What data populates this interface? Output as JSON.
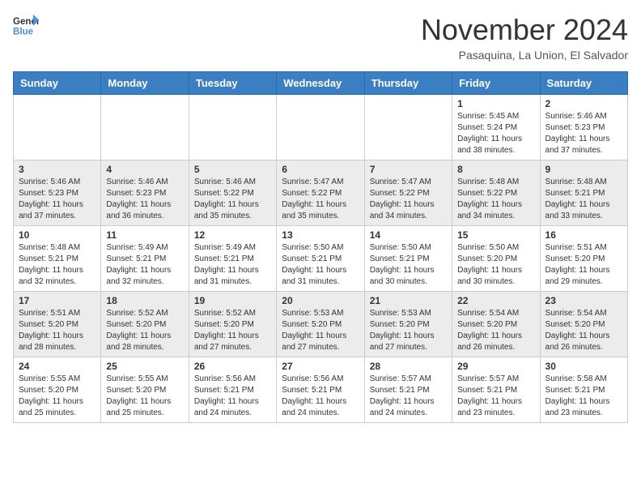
{
  "logo": {
    "line1": "General",
    "line2": "Blue"
  },
  "header": {
    "month": "November 2024",
    "location": "Pasaquina, La Union, El Salvador"
  },
  "weekdays": [
    "Sunday",
    "Monday",
    "Tuesday",
    "Wednesday",
    "Thursday",
    "Friday",
    "Saturday"
  ],
  "weeks": [
    [
      {
        "day": "",
        "info": ""
      },
      {
        "day": "",
        "info": ""
      },
      {
        "day": "",
        "info": ""
      },
      {
        "day": "",
        "info": ""
      },
      {
        "day": "",
        "info": ""
      },
      {
        "day": "1",
        "info": "Sunrise: 5:45 AM\nSunset: 5:24 PM\nDaylight: 11 hours\nand 38 minutes."
      },
      {
        "day": "2",
        "info": "Sunrise: 5:46 AM\nSunset: 5:23 PM\nDaylight: 11 hours\nand 37 minutes."
      }
    ],
    [
      {
        "day": "3",
        "info": "Sunrise: 5:46 AM\nSunset: 5:23 PM\nDaylight: 11 hours\nand 37 minutes."
      },
      {
        "day": "4",
        "info": "Sunrise: 5:46 AM\nSunset: 5:23 PM\nDaylight: 11 hours\nand 36 minutes."
      },
      {
        "day": "5",
        "info": "Sunrise: 5:46 AM\nSunset: 5:22 PM\nDaylight: 11 hours\nand 35 minutes."
      },
      {
        "day": "6",
        "info": "Sunrise: 5:47 AM\nSunset: 5:22 PM\nDaylight: 11 hours\nand 35 minutes."
      },
      {
        "day": "7",
        "info": "Sunrise: 5:47 AM\nSunset: 5:22 PM\nDaylight: 11 hours\nand 34 minutes."
      },
      {
        "day": "8",
        "info": "Sunrise: 5:48 AM\nSunset: 5:22 PM\nDaylight: 11 hours\nand 34 minutes."
      },
      {
        "day": "9",
        "info": "Sunrise: 5:48 AM\nSunset: 5:21 PM\nDaylight: 11 hours\nand 33 minutes."
      }
    ],
    [
      {
        "day": "10",
        "info": "Sunrise: 5:48 AM\nSunset: 5:21 PM\nDaylight: 11 hours\nand 32 minutes."
      },
      {
        "day": "11",
        "info": "Sunrise: 5:49 AM\nSunset: 5:21 PM\nDaylight: 11 hours\nand 32 minutes."
      },
      {
        "day": "12",
        "info": "Sunrise: 5:49 AM\nSunset: 5:21 PM\nDaylight: 11 hours\nand 31 minutes."
      },
      {
        "day": "13",
        "info": "Sunrise: 5:50 AM\nSunset: 5:21 PM\nDaylight: 11 hours\nand 31 minutes."
      },
      {
        "day": "14",
        "info": "Sunrise: 5:50 AM\nSunset: 5:21 PM\nDaylight: 11 hours\nand 30 minutes."
      },
      {
        "day": "15",
        "info": "Sunrise: 5:50 AM\nSunset: 5:20 PM\nDaylight: 11 hours\nand 30 minutes."
      },
      {
        "day": "16",
        "info": "Sunrise: 5:51 AM\nSunset: 5:20 PM\nDaylight: 11 hours\nand 29 minutes."
      }
    ],
    [
      {
        "day": "17",
        "info": "Sunrise: 5:51 AM\nSunset: 5:20 PM\nDaylight: 11 hours\nand 28 minutes."
      },
      {
        "day": "18",
        "info": "Sunrise: 5:52 AM\nSunset: 5:20 PM\nDaylight: 11 hours\nand 28 minutes."
      },
      {
        "day": "19",
        "info": "Sunrise: 5:52 AM\nSunset: 5:20 PM\nDaylight: 11 hours\nand 27 minutes."
      },
      {
        "day": "20",
        "info": "Sunrise: 5:53 AM\nSunset: 5:20 PM\nDaylight: 11 hours\nand 27 minutes."
      },
      {
        "day": "21",
        "info": "Sunrise: 5:53 AM\nSunset: 5:20 PM\nDaylight: 11 hours\nand 27 minutes."
      },
      {
        "day": "22",
        "info": "Sunrise: 5:54 AM\nSunset: 5:20 PM\nDaylight: 11 hours\nand 26 minutes."
      },
      {
        "day": "23",
        "info": "Sunrise: 5:54 AM\nSunset: 5:20 PM\nDaylight: 11 hours\nand 26 minutes."
      }
    ],
    [
      {
        "day": "24",
        "info": "Sunrise: 5:55 AM\nSunset: 5:20 PM\nDaylight: 11 hours\nand 25 minutes."
      },
      {
        "day": "25",
        "info": "Sunrise: 5:55 AM\nSunset: 5:20 PM\nDaylight: 11 hours\nand 25 minutes."
      },
      {
        "day": "26",
        "info": "Sunrise: 5:56 AM\nSunset: 5:21 PM\nDaylight: 11 hours\nand 24 minutes."
      },
      {
        "day": "27",
        "info": "Sunrise: 5:56 AM\nSunset: 5:21 PM\nDaylight: 11 hours\nand 24 minutes."
      },
      {
        "day": "28",
        "info": "Sunrise: 5:57 AM\nSunset: 5:21 PM\nDaylight: 11 hours\nand 24 minutes."
      },
      {
        "day": "29",
        "info": "Sunrise: 5:57 AM\nSunset: 5:21 PM\nDaylight: 11 hours\nand 23 minutes."
      },
      {
        "day": "30",
        "info": "Sunrise: 5:58 AM\nSunset: 5:21 PM\nDaylight: 11 hours\nand 23 minutes."
      }
    ]
  ]
}
